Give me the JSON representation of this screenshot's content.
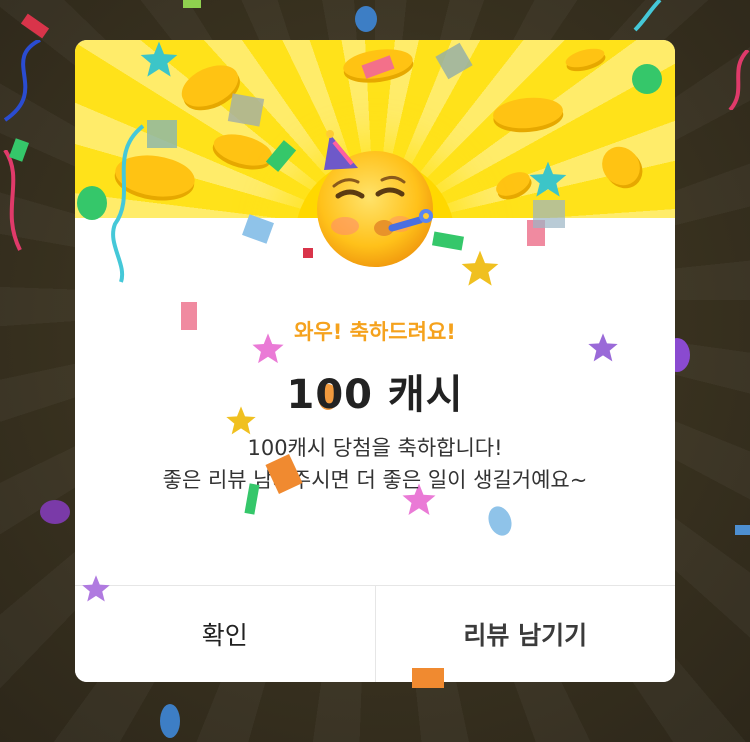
{
  "dialog": {
    "subtitle": "와우! 축하드려요!",
    "amount_prefix": "1",
    "amount_highlight": "0",
    "amount_suffix": "0 캐시",
    "message_line1": "100캐시 당첨을 축하합니다!",
    "message_line2": "좋은 리뷰 남겨주시면 더 좋은 일이 생길거예요~"
  },
  "buttons": {
    "confirm_label": "확인",
    "review_label": "리뷰 남기기"
  },
  "icons": {
    "header_emoji": "partying-face-icon"
  },
  "colors": {
    "header_yellow": "#ffe21a",
    "subtitle_orange": "#f5a21d",
    "amount_dark": "#222222",
    "backdrop": "#3a3322",
    "divider": "#e6e6e6"
  }
}
